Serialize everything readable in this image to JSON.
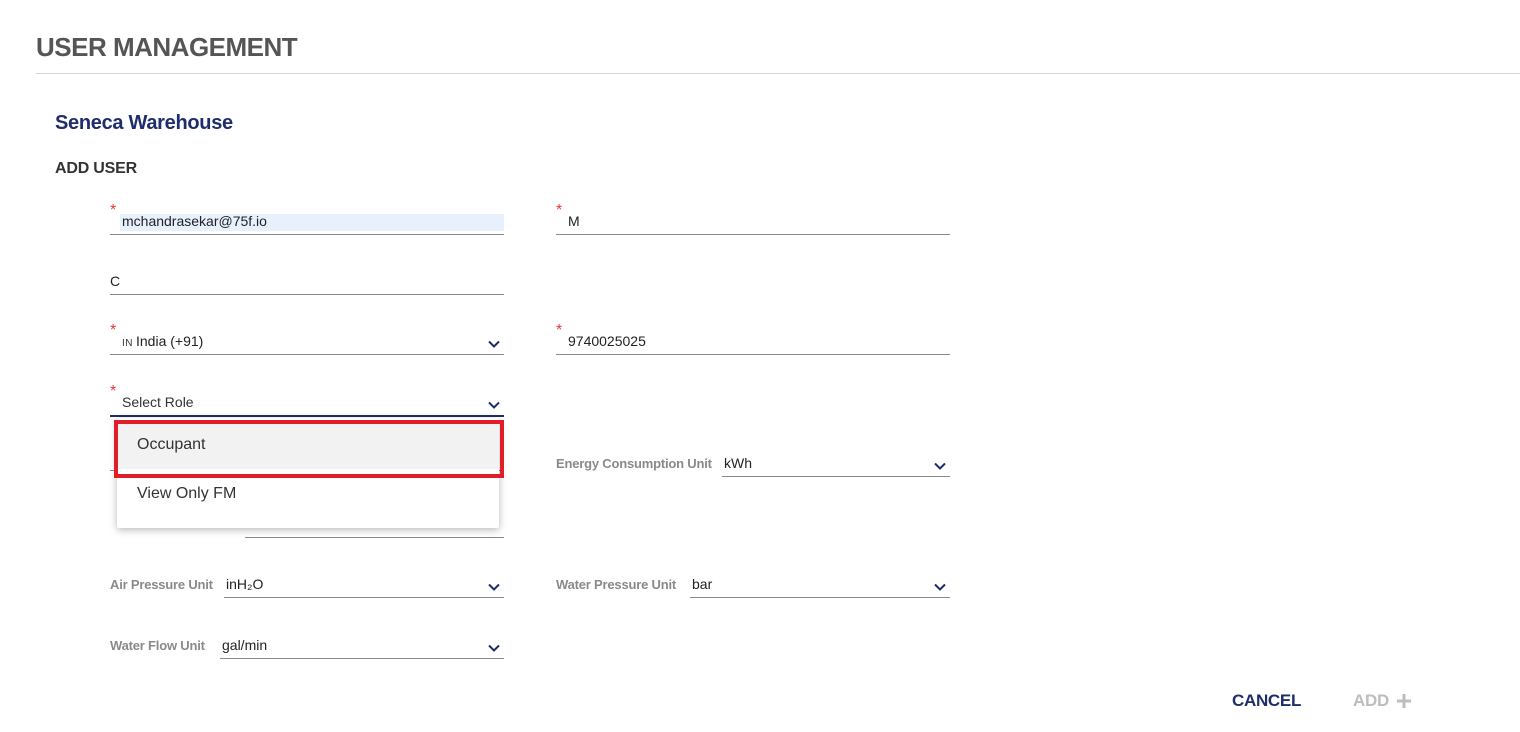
{
  "page": {
    "title": "USER MANAGEMENT"
  },
  "building": {
    "name": "Seneca Warehouse"
  },
  "form": {
    "section_title": "ADD USER",
    "email": {
      "value": "mchandrasekar@75f.io",
      "required": true
    },
    "first_name": {
      "value": "M",
      "required": true
    },
    "last_name": {
      "value": "C",
      "required": false
    },
    "country": {
      "flag_code": "IN",
      "value": "India (+91)",
      "required": true
    },
    "phone": {
      "value": "9740025025",
      "required": true
    },
    "role": {
      "placeholder": "Select Role",
      "required": true,
      "options": [
        "Occupant",
        "View Only FM"
      ],
      "hovered": "Occupant"
    }
  },
  "units": {
    "energy": {
      "label": "Energy Consumption Unit",
      "value": "kWh"
    },
    "air_pressure": {
      "label": "Air Pressure Unit",
      "value": "inH₂O"
    },
    "water_pressure": {
      "label": "Water Pressure Unit",
      "value": "bar"
    },
    "water_flow": {
      "label": "Water Flow Unit",
      "value": "gal/min"
    }
  },
  "actions": {
    "cancel_label": "CANCEL",
    "add_label": "ADD"
  },
  "colors": {
    "brand": "#1f2d6b",
    "required": "#e53935",
    "highlight": "#e11d2a",
    "disabled": "#bdbdbd"
  }
}
